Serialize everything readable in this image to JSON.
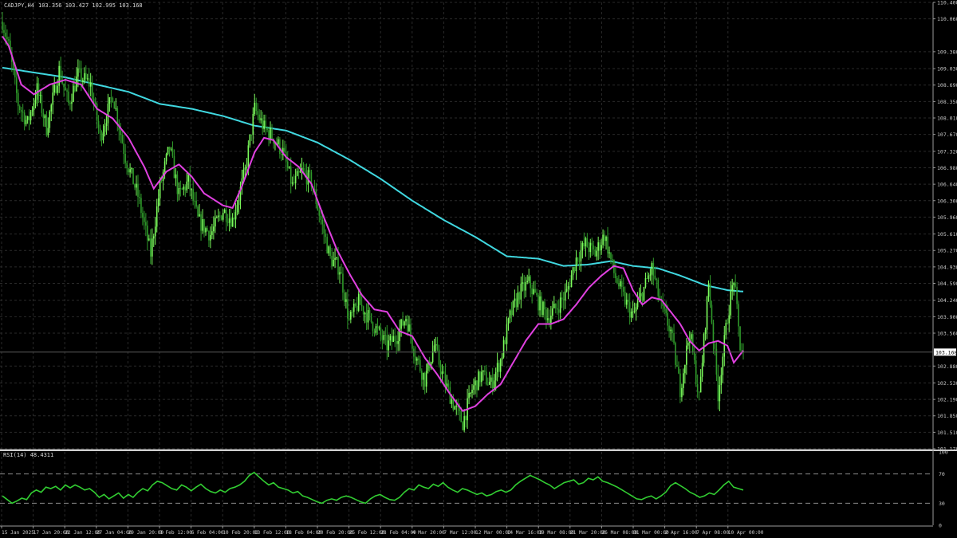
{
  "header": {
    "symbol": "CADJPY,H4",
    "ohlc": "103.356 103.427 102.995 103.168"
  },
  "rsi_header": "RSI(14) 48.4311",
  "colors": {
    "background": "#000000",
    "grid": "#2a2a2a",
    "axis": "#c8c8c8",
    "candle_up": "#7cfc5c",
    "candle_down": "#2f9a2a",
    "ma_fast": "#e040e0",
    "ma_slow": "#40d8e0",
    "rsi_line": "#32cd32",
    "last_price_label_bg": "#ffffff"
  },
  "chart_data": [
    {
      "type": "candlestick",
      "title": "CADJPY,H4",
      "y_ticks": [
        "110.400",
        "110.060",
        "109.380",
        "109.030",
        "108.690",
        "108.350",
        "108.010",
        "107.670",
        "107.320",
        "106.980",
        "106.640",
        "106.300",
        "105.960",
        "105.610",
        "105.270",
        "104.930",
        "104.590",
        "104.240",
        "103.900",
        "103.560",
        "102.880",
        "102.530",
        "102.190",
        "101.850",
        "101.510",
        "101.170"
      ],
      "ylim": [
        101.17,
        110.4
      ],
      "last_price": "103.168",
      "x_ticks": [
        "15 Jan 2025",
        "17 Jan 20:00",
        "22 Jan 12:00",
        "27 Jan 04:00",
        "29 Jan 20:00",
        "3 Feb 12:00",
        "6 Feb 04:00",
        "10 Feb 20:00",
        "13 Feb 12:00",
        "18 Feb 04:00",
        "20 Feb 20:00",
        "25 Feb 12:00",
        "28 Feb 04:00",
        "4 Mar 20:00",
        "7 Mar 12:00",
        "12 Mar 00:00",
        "14 Mar 16:00",
        "19 Mar 08:00",
        "21 Mar 20:00",
        "26 Mar 08:00",
        "31 Mar 00:00",
        "2 Apr 16:00",
        "7 Apr 08:00",
        "10 Apr 00:00"
      ],
      "price_anchors": [
        [
          0,
          110.0
        ],
        [
          4,
          109.5
        ],
        [
          10,
          108.3
        ],
        [
          16,
          107.9
        ],
        [
          22,
          108.6
        ],
        [
          28,
          107.8
        ],
        [
          36,
          109.0
        ],
        [
          42,
          108.3
        ],
        [
          48,
          108.9
        ],
        [
          56,
          108.7
        ],
        [
          62,
          107.6
        ],
        [
          70,
          108.5
        ],
        [
          78,
          107.2
        ],
        [
          86,
          106.4
        ],
        [
          94,
          105.2
        ],
        [
          100,
          106.6
        ],
        [
          106,
          107.4
        ],
        [
          112,
          106.4
        ],
        [
          118,
          106.7
        ],
        [
          124,
          105.9
        ],
        [
          132,
          105.6
        ],
        [
          140,
          106.1
        ],
        [
          146,
          105.9
        ],
        [
          154,
          106.9
        ],
        [
          160,
          108.2
        ],
        [
          166,
          107.8
        ],
        [
          172,
          107.6
        ],
        [
          178,
          107.3
        ],
        [
          184,
          106.6
        ],
        [
          190,
          106.9
        ],
        [
          196,
          106.7
        ],
        [
          202,
          105.9
        ],
        [
          208,
          105.1
        ],
        [
          214,
          104.9
        ],
        [
          220,
          103.8
        ],
        [
          226,
          104.2
        ],
        [
          232,
          103.9
        ],
        [
          238,
          103.6
        ],
        [
          244,
          103.3
        ],
        [
          250,
          103.5
        ],
        [
          256,
          103.9
        ],
        [
          262,
          103.1
        ],
        [
          268,
          102.6
        ],
        [
          274,
          103.3
        ],
        [
          280,
          102.6
        ],
        [
          286,
          102.1
        ],
        [
          292,
          101.7
        ],
        [
          298,
          102.4
        ],
        [
          304,
          102.7
        ],
        [
          310,
          102.5
        ],
        [
          316,
          103.0
        ],
        [
          322,
          103.9
        ],
        [
          328,
          104.4
        ],
        [
          334,
          104.6
        ],
        [
          340,
          104.2
        ],
        [
          346,
          103.9
        ],
        [
          352,
          104.1
        ],
        [
          358,
          104.4
        ],
        [
          364,
          105.1
        ],
        [
          370,
          105.4
        ],
        [
          376,
          105.2
        ],
        [
          382,
          105.6
        ],
        [
          388,
          104.8
        ],
        [
          394,
          104.3
        ],
        [
          400,
          103.9
        ],
        [
          406,
          104.4
        ],
        [
          412,
          104.9
        ],
        [
          418,
          104.1
        ],
        [
          424,
          103.6
        ],
        [
          430,
          102.4
        ],
        [
          436,
          103.6
        ],
        [
          442,
          102.2
        ],
        [
          448,
          104.6
        ],
        [
          454,
          102.3
        ],
        [
          460,
          103.9
        ],
        [
          464,
          104.7
        ],
        [
          468,
          103.3
        ],
        [
          470,
          103.17
        ]
      ],
      "ma_fast_anchors": [
        [
          0,
          109.7
        ],
        [
          4,
          109.5
        ],
        [
          12,
          108.7
        ],
        [
          20,
          108.5
        ],
        [
          30,
          108.7
        ],
        [
          40,
          108.8
        ],
        [
          50,
          108.7
        ],
        [
          60,
          108.2
        ],
        [
          70,
          108.0
        ],
        [
          80,
          107.6
        ],
        [
          90,
          107.0
        ],
        [
          96,
          106.55
        ],
        [
          104,
          106.9
        ],
        [
          112,
          107.05
        ],
        [
          120,
          106.8
        ],
        [
          128,
          106.45
        ],
        [
          140,
          106.2
        ],
        [
          146,
          106.15
        ],
        [
          152,
          106.6
        ],
        [
          160,
          107.3
        ],
        [
          166,
          107.6
        ],
        [
          172,
          107.55
        ],
        [
          180,
          107.2
        ],
        [
          188,
          107.0
        ],
        [
          196,
          106.65
        ],
        [
          204,
          105.95
        ],
        [
          212,
          105.3
        ],
        [
          220,
          104.8
        ],
        [
          228,
          104.35
        ],
        [
          236,
          104.05
        ],
        [
          244,
          104.0
        ],
        [
          252,
          103.6
        ],
        [
          260,
          103.5
        ],
        [
          268,
          103.05
        ],
        [
          276,
          102.7
        ],
        [
          284,
          102.3
        ],
        [
          292,
          101.95
        ],
        [
          300,
          102.05
        ],
        [
          308,
          102.3
        ],
        [
          316,
          102.5
        ],
        [
          324,
          102.95
        ],
        [
          332,
          103.4
        ],
        [
          340,
          103.75
        ],
        [
          348,
          103.75
        ],
        [
          356,
          103.85
        ],
        [
          364,
          104.15
        ],
        [
          372,
          104.5
        ],
        [
          380,
          104.75
        ],
        [
          388,
          104.95
        ],
        [
          394,
          104.9
        ],
        [
          400,
          104.45
        ],
        [
          406,
          104.15
        ],
        [
          412,
          104.3
        ],
        [
          418,
          104.25
        ],
        [
          424,
          104.0
        ],
        [
          430,
          103.75
        ],
        [
          436,
          103.4
        ],
        [
          442,
          103.2
        ],
        [
          448,
          103.35
        ],
        [
          454,
          103.4
        ],
        [
          460,
          103.3
        ],
        [
          464,
          102.95
        ],
        [
          470,
          103.2
        ]
      ],
      "ma_slow_anchors": [
        [
          0,
          109.05
        ],
        [
          20,
          108.95
        ],
        [
          40,
          108.85
        ],
        [
          60,
          108.7
        ],
        [
          80,
          108.55
        ],
        [
          100,
          108.3
        ],
        [
          120,
          108.2
        ],
        [
          140,
          108.05
        ],
        [
          160,
          107.85
        ],
        [
          180,
          107.75
        ],
        [
          200,
          107.5
        ],
        [
          220,
          107.15
        ],
        [
          240,
          106.75
        ],
        [
          260,
          106.3
        ],
        [
          280,
          105.9
        ],
        [
          300,
          105.55
        ],
        [
          320,
          105.15
        ],
        [
          340,
          105.1
        ],
        [
          356,
          104.95
        ],
        [
          372,
          104.98
        ],
        [
          386,
          105.05
        ],
        [
          400,
          104.95
        ],
        [
          416,
          104.9
        ],
        [
          430,
          104.75
        ],
        [
          446,
          104.55
        ],
        [
          460,
          104.45
        ],
        [
          470,
          104.42
        ]
      ]
    },
    {
      "type": "line",
      "title": "RSI(14) 48.4311",
      "ylim": [
        0,
        100
      ],
      "y_ticks": [
        "100",
        "70",
        "30",
        "0"
      ],
      "levels": [
        70,
        30
      ],
      "values": [
        40,
        35,
        30,
        33,
        37,
        35,
        44,
        48,
        45,
        52,
        50,
        53,
        48,
        55,
        51,
        55,
        52,
        48,
        50,
        45,
        38,
        42,
        36,
        40,
        44,
        37,
        42,
        38,
        45,
        50,
        47,
        55,
        60,
        58,
        54,
        50,
        48,
        55,
        52,
        47,
        52,
        56,
        50,
        46,
        44,
        48,
        45,
        50,
        52,
        55,
        60,
        68,
        72,
        66,
        60,
        55,
        58,
        52,
        50,
        48,
        44,
        46,
        40,
        38,
        35,
        32,
        30,
        34,
        36,
        34,
        38,
        40,
        38,
        35,
        32,
        30,
        36,
        40,
        42,
        38,
        35,
        34,
        38,
        45,
        50,
        48,
        55,
        52,
        50,
        56,
        53,
        58,
        52,
        48,
        45,
        50,
        48,
        45,
        42,
        44,
        40,
        42,
        46,
        48,
        45,
        48,
        55,
        60,
        64,
        68,
        65,
        62,
        58,
        55,
        50,
        54,
        58,
        60,
        62,
        56,
        58,
        64,
        62,
        66,
        60,
        58,
        55,
        52,
        48,
        44,
        40,
        36,
        35,
        38,
        40,
        36,
        40,
        45,
        54,
        58,
        54,
        50,
        45,
        42,
        38,
        40,
        44,
        42,
        48,
        55,
        60,
        52,
        50,
        48
      ]
    }
  ]
}
